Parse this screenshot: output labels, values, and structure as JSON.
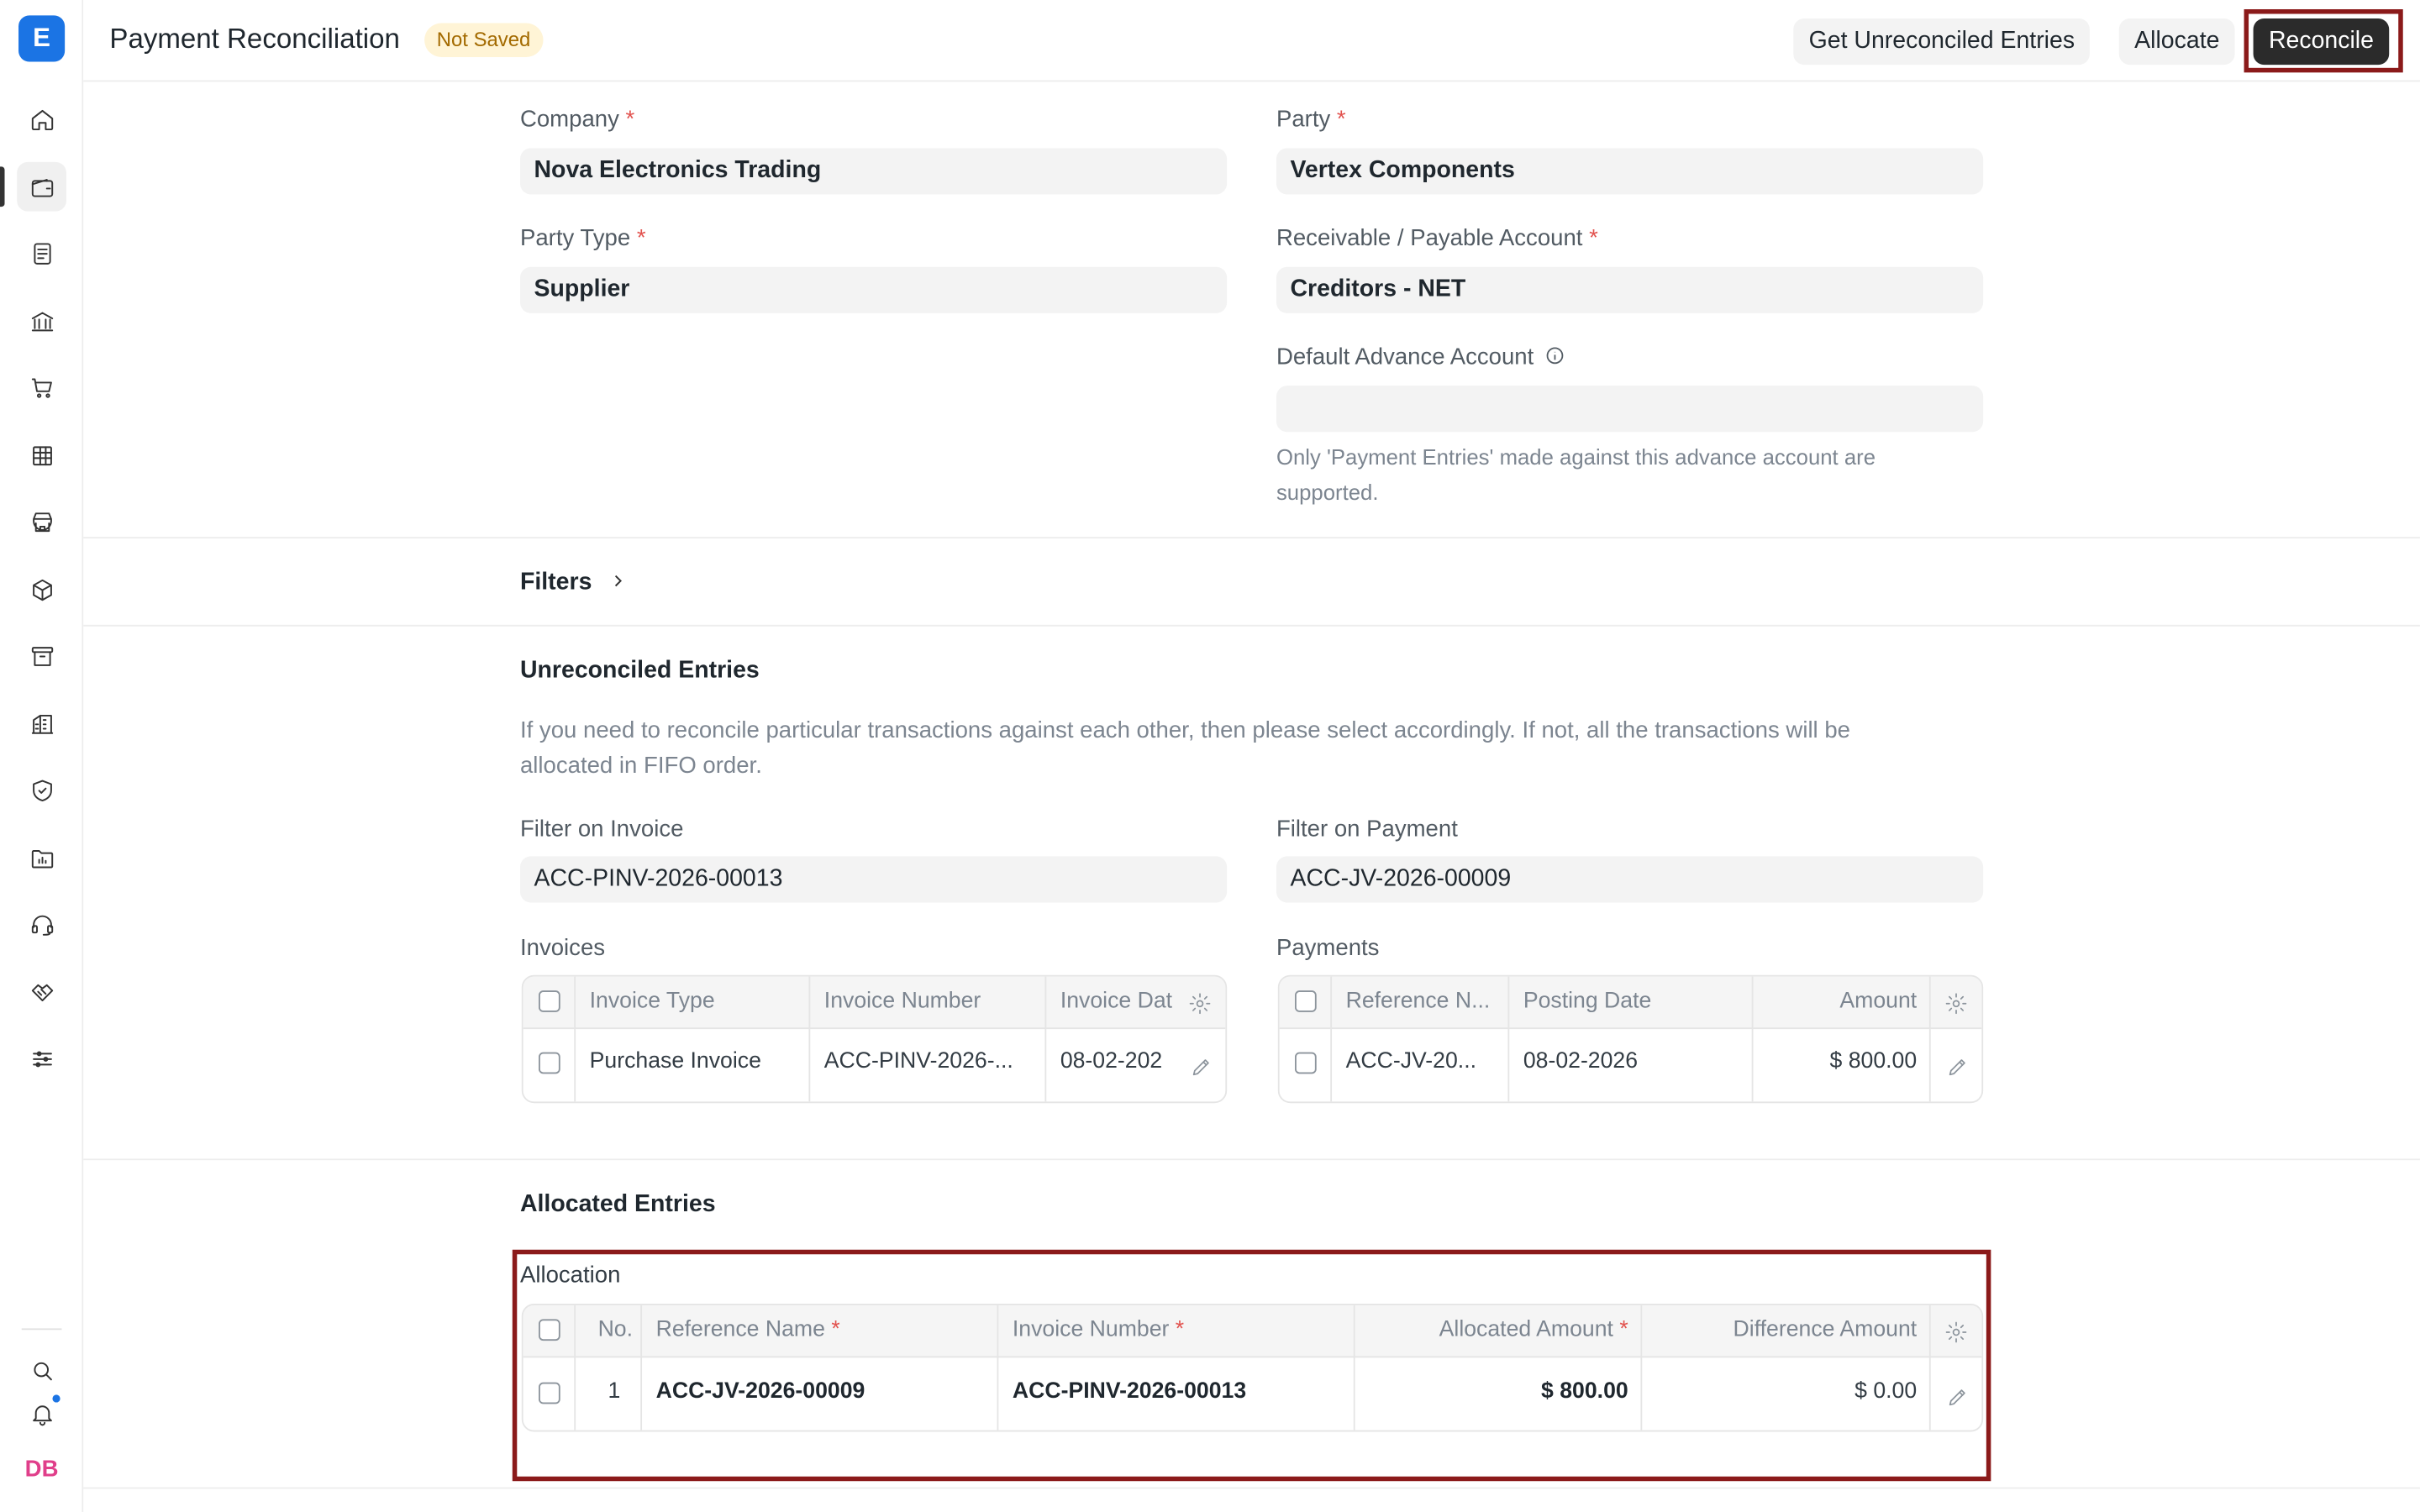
{
  "sidebar": {
    "logo": "E",
    "items": [
      {
        "icon": "home-icon"
      },
      {
        "icon": "wallet-icon",
        "active": true
      },
      {
        "icon": "document-icon"
      },
      {
        "icon": "bank-icon"
      },
      {
        "icon": "cart-icon"
      },
      {
        "icon": "table-icon"
      },
      {
        "icon": "store-icon"
      },
      {
        "icon": "box-icon"
      },
      {
        "icon": "archive-icon"
      },
      {
        "icon": "building-icon"
      },
      {
        "icon": "shield-icon"
      },
      {
        "icon": "folder-chart-icon"
      },
      {
        "icon": "headset-icon"
      },
      {
        "icon": "handshake-icon"
      },
      {
        "icon": "sliders-icon"
      }
    ],
    "search_icon": "search-icon",
    "bell_icon": "bell-icon",
    "avatar_initials": "DB"
  },
  "header": {
    "title": "Payment Reconciliation",
    "status": "Not Saved",
    "get_unreconciled_label": "Get Unreconciled Entries",
    "allocate_label": "Allocate",
    "reconcile_label": "Reconcile"
  },
  "form": {
    "company_label": "Company",
    "company_value": "Nova Electronics Trading",
    "party_label": "Party",
    "party_value": "Vertex Components",
    "party_type_label": "Party Type",
    "party_type_value": "Supplier",
    "account_label": "Receivable / Payable Account",
    "account_value": "Creditors - NET",
    "advance_label": "Default Advance Account",
    "advance_value": "",
    "advance_help_1": "Only 'Payment Entries' made against this advance account are",
    "advance_help_2": "supported.",
    "required_mark": "*"
  },
  "filters": {
    "label": "Filters"
  },
  "unreconciled": {
    "title": "Unreconciled Entries",
    "desc_1": "If you need to reconcile particular transactions against each other, then please select accordingly. If not, all the transactions will be",
    "desc_2": "allocated in FIFO order.",
    "filter_invoice_label": "Filter on Invoice",
    "filter_invoice_value": "ACC-PINV-2026-00013",
    "filter_payment_label": "Filter on Payment",
    "filter_payment_value": "ACC-JV-2026-00009",
    "invoices_label": "Invoices",
    "invoices_columns": [
      "Invoice Type",
      "Invoice Number",
      "Invoice Dat"
    ],
    "invoices_rows": [
      {
        "invoice_type": "Purchase Invoice",
        "invoice_number": "ACC-PINV-2026-...",
        "invoice_date": "08-02-202"
      }
    ],
    "payments_label": "Payments",
    "payments_columns": [
      "Reference N...",
      "Posting Date",
      "Amount"
    ],
    "payments_rows": [
      {
        "reference": "ACC-JV-20...",
        "posting_date": "08-02-2026",
        "amount": "$ 800.00"
      }
    ]
  },
  "allocated": {
    "title": "Allocated Entries",
    "table_label": "Allocation",
    "columns": [
      "No.",
      "Reference Name",
      "Invoice Number",
      "Allocated Amount",
      "Difference Amount"
    ],
    "rows": [
      {
        "no": "1",
        "reference_name": "ACC-JV-2026-00009",
        "invoice_number": "ACC-PINV-2026-00013",
        "allocated_amount": "$ 800.00",
        "difference_amount": "$ 0.00"
      }
    ]
  },
  "colors": {
    "accent": "#1b74e4",
    "primary_button": "#2b2b2b",
    "highlight_border": "#8b1a1a",
    "required": "#e2534f",
    "badge_bg": "#fff4d6"
  }
}
